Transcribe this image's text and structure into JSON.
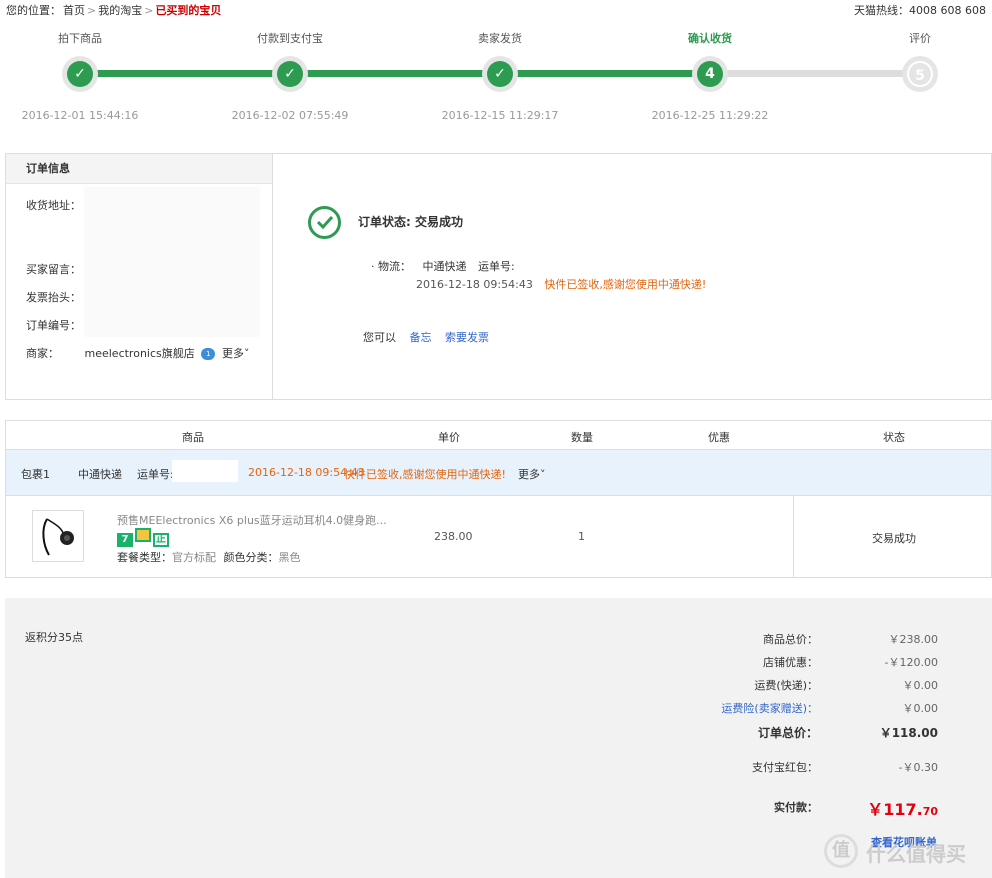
{
  "breadcrumb": {
    "prefix": "您的位置：",
    "items": [
      "首页",
      "我的淘宝",
      "已买到的宝贝"
    ],
    "sep": ">"
  },
  "hotline": "天猫热线：4008 608 608",
  "progress": {
    "steps": [
      {
        "label": "拍下商品",
        "time": "2016-12-01 15:44:16",
        "mark": "✓",
        "state": "done"
      },
      {
        "label": "付款到支付宝",
        "time": "2016-12-02 07:55:49",
        "mark": "✓",
        "state": "done"
      },
      {
        "label": "卖家发货",
        "time": "2016-12-15 11:29:17",
        "mark": "✓",
        "state": "done"
      },
      {
        "label": "确认收货",
        "time": "2016-12-25 11:29:22",
        "mark": "4",
        "state": "current"
      },
      {
        "label": "评价",
        "time": "",
        "mark": "5",
        "state": "future"
      }
    ]
  },
  "order_info": {
    "title": "订单信息",
    "address_label": "收货地址：",
    "message_label": "买家留言：",
    "invoice_label": "发票抬头：",
    "order_no_label": "订单编号：",
    "seller_label": "商家：",
    "seller_name": "meelectronics旗舰店",
    "seller_badge": "1",
    "more": "更多˅"
  },
  "status": {
    "text": "订单状态: 交易成功",
    "logistics_label": "· 物流：",
    "carrier": "中通快递",
    "tracking_label": "运单号:",
    "log_time": "2016-12-18 09:54:43",
    "log_msg": "快件已签收,感谢您使用中通快递!",
    "actions_label": "您可以",
    "action_note": "备忘",
    "action_invoice": "索要发票"
  },
  "goods": {
    "headers": {
      "product": "商品",
      "price": "单价",
      "qty": "数量",
      "discount": "优惠",
      "status": "状态"
    },
    "package": {
      "name": "包裹1",
      "carrier": "中通快递",
      "tracking_label": "运单号:",
      "time": "2016-12-18 09:54:43",
      "msg": "快件已签收,感谢您使用中通快递!",
      "more": "更多˅"
    },
    "item": {
      "title": "预售MEElectronics X6 plus蓝牙运动耳机4.0健身跑...",
      "tags": [
        "7",
        "",
        "正"
      ],
      "spec_label1": "套餐类型：",
      "spec_val1": "官方标配",
      "spec_label2": "颜色分类：",
      "spec_val2": "黑色",
      "price": "238.00",
      "qty": "1",
      "status": "交易成功"
    }
  },
  "totals": {
    "points": "返积分35点",
    "lines": [
      {
        "label": "商品总价：",
        "value": "￥238.00",
        "style": "normal"
      },
      {
        "label": "店铺优惠：",
        "value": "-￥120.00",
        "style": "normal"
      },
      {
        "label": "运费(快递)：",
        "value": "￥0.00",
        "style": "normal"
      },
      {
        "label": "运费险(卖家赠送)：",
        "value": "￥0.00",
        "style": "blue"
      },
      {
        "label": "订单总价：",
        "value": "￥118.00",
        "style": "bold"
      },
      {
        "label": "支付宝红包：",
        "value": "-￥0.30",
        "style": "normal"
      }
    ],
    "paid_label": "实付款：",
    "paid_main": "￥117.",
    "paid_cents": "70",
    "huabei": "查看花呗账单"
  },
  "watermark": {
    "circle": "值",
    "text": "什么值得买"
  },
  "colors": {
    "green": "#2d9b50",
    "orange": "#e4650d",
    "red": "#e4000f",
    "link": "#3366cc"
  }
}
